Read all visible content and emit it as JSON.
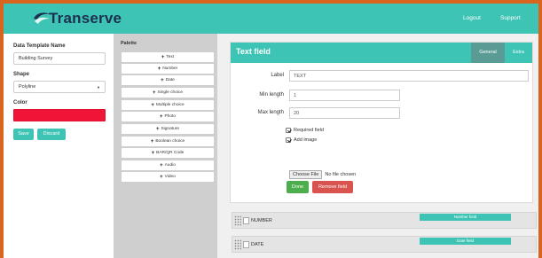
{
  "header": {
    "brand": "Transerve",
    "nav": {
      "logout": "Logout",
      "support": "Support"
    },
    "colors": {
      "bar": "#3ec4b4",
      "brand_text": "#1d2f4f",
      "page_border": "#d9641e"
    }
  },
  "left_panel": {
    "template_name_label": "Data Template Name",
    "template_name_value": "Building Survey",
    "shape_label": "Shape",
    "shape_value": "Polyline",
    "color_label": "Color",
    "color_value": "#f01436",
    "save_label": "Save",
    "discard_label": "Discard"
  },
  "palette": {
    "title": "Palette",
    "items": [
      "Text",
      "Number",
      "Date",
      "Single choice",
      "Multiple choice",
      "Photo",
      "Signature",
      "Boolean choice",
      "BAR/QR Code",
      "Audio",
      "Video"
    ]
  },
  "editor": {
    "title": "Text field",
    "tabs": {
      "general": "General",
      "extra": "Extra"
    },
    "label_label": "Label",
    "label_value": "TEXT",
    "min_length_label": "Min length",
    "min_length_value": "1",
    "max_length_label": "Max length",
    "max_length_value": "20",
    "required_label": "Required field",
    "add_image_label": "Add image",
    "choose_file_label": "Choose File",
    "no_file_text": "No file chosen",
    "done_label": "Done",
    "remove_label": "Remove field"
  },
  "fields": [
    {
      "name": "NUMBER",
      "type_badge": "Number field"
    },
    {
      "name": "DATE",
      "type_badge": "Date field"
    }
  ]
}
